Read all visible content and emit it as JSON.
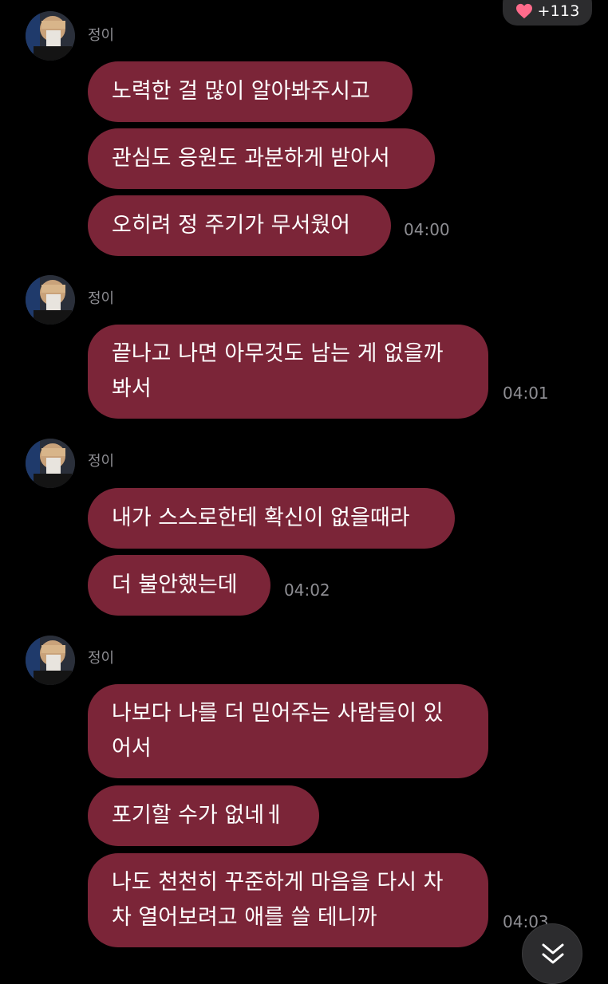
{
  "header": {
    "like_count": "+113",
    "like_icon": "heart-icon"
  },
  "colors": {
    "background": "#000000",
    "bubble": "#7b2538",
    "muted_text": "#8e8e93",
    "heart": "#ff6b8b"
  },
  "groups": [
    {
      "sender": "정이",
      "messages": [
        "노력한 걸 많이 알아봐주시고",
        "관심도 응원도 과분하게 받아서",
        "오히려 정 주기가 무서웠어"
      ],
      "time": "04:00"
    },
    {
      "sender": "정이",
      "messages": [
        "끝나고 나면 아무것도 남는 게 없을까\n봐서"
      ],
      "time": "04:01"
    },
    {
      "sender": "정이",
      "messages": [
        "내가 스스로한테 확신이 없을때라",
        "더 불안했는데"
      ],
      "time": "04:02"
    },
    {
      "sender": "정이",
      "messages": [
        "나보다 나를 더 믿어주는 사람들이 있\n어서",
        "포기할 수가 없네ㅔ",
        "나도 천천히 꾸준하게 마음을 다시 차\n차 열어보려고 애를 쓸 테니까"
      ],
      "time": "04:03"
    }
  ],
  "scroll_button_icon": "chevron-down-icon"
}
